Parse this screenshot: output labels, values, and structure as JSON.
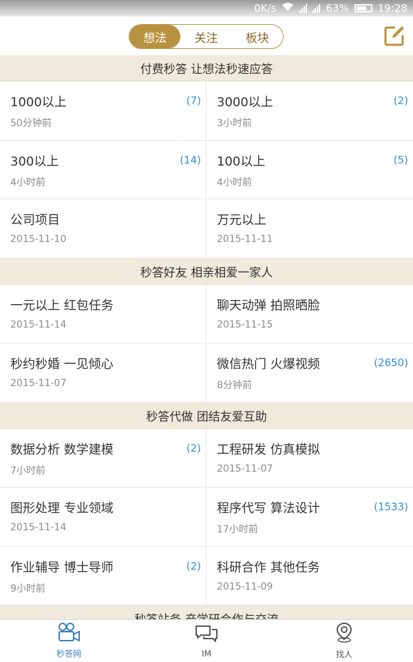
{
  "status_bar": {
    "speed": "0K/s",
    "battery": "63%",
    "time": "19:28",
    "icons": [
      "wifi-icon",
      "3g-signal-icon",
      "2g-signal-icon",
      "battery-icon"
    ]
  },
  "header": {
    "tabs": [
      {
        "label": "想法",
        "active": true
      },
      {
        "label": "关注",
        "active": false
      },
      {
        "label": "板块",
        "active": false
      }
    ],
    "compose_icon": "compose-icon"
  },
  "sections": [
    {
      "title": "付费秒答 让想法秒速应答",
      "items": [
        {
          "title": "1000以上",
          "time": "50分钟前",
          "count": "(7)"
        },
        {
          "title": "3000以上",
          "time": "3小时前",
          "count": "(2)"
        },
        {
          "title": "300以上",
          "time": "4小时前",
          "count": "(14)"
        },
        {
          "title": "100以上",
          "time": "4小时前",
          "count": "(5)"
        },
        {
          "title": "公司项目",
          "time": "2015-11-10",
          "count": ""
        },
        {
          "title": "万元以上",
          "time": "2015-11-11",
          "count": ""
        }
      ]
    },
    {
      "title": "秒答好友 相亲相爱一家人",
      "items": [
        {
          "title": "一元以上 红包任务",
          "time": "2015-11-14",
          "count": ""
        },
        {
          "title": "聊天动弹 拍照晒脸",
          "time": "2015-11-15",
          "count": ""
        },
        {
          "title": "秒约秒婚 一见倾心",
          "time": "2015-11-07",
          "count": ""
        },
        {
          "title": "微信热门 火爆视频",
          "time": "8分钟前",
          "count": "(2650)"
        }
      ]
    },
    {
      "title": "秒答代做 团结友爱互助",
      "items": [
        {
          "title": "数据分析 数学建模",
          "time": "7小时前",
          "count": "(2)"
        },
        {
          "title": "工程研发 仿真模拟",
          "time": "2015-11-07",
          "count": ""
        },
        {
          "title": "图形处理 专业领域",
          "time": "2015-11-14",
          "count": ""
        },
        {
          "title": "程序代写 算法设计",
          "time": "17小时前",
          "count": "(1533)"
        },
        {
          "title": "作业辅导 博士导师",
          "time": "9小时前",
          "count": "(2)"
        },
        {
          "title": "科研合作 其他任务",
          "time": "2015-11-09",
          "count": ""
        }
      ]
    },
    {
      "title": "秒答站务 产学研合作与交流",
      "items": []
    }
  ],
  "tabbar": [
    {
      "label": "秒答网",
      "icon": "video-camera-icon",
      "active": true
    },
    {
      "label": "IM",
      "icon": "chat-bubbles-icon",
      "active": false
    },
    {
      "label": "找人",
      "icon": "location-pin-icon",
      "active": false
    }
  ],
  "colors": {
    "accent_gold": "#b8923e",
    "section_bg": "#efeadb",
    "count_blue": "#2f8ed6",
    "tab_active_blue": "#3b7fc4"
  }
}
